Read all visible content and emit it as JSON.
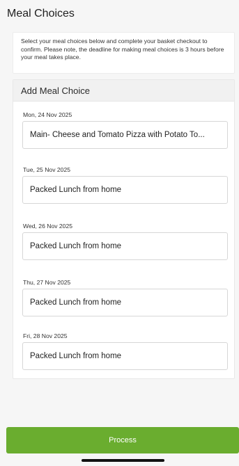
{
  "page": {
    "title": "Meal Choices"
  },
  "info": {
    "text": "Select your meal choices below and complete your basket checkout to confirm. Please note, the deadline for making meal choices is 3 hours before your meal takes place."
  },
  "meal_choice": {
    "header": "Add Meal Choice",
    "days": [
      {
        "date": "Mon, 24 Nov 2025",
        "selection": "Main- Cheese and Tomato Pizza with Potato To..."
      },
      {
        "date": "Tue, 25 Nov 2025",
        "selection": "Packed Lunch from home"
      },
      {
        "date": "Wed, 26 Nov 2025",
        "selection": "Packed Lunch from home"
      },
      {
        "date": "Thu, 27 Nov 2025",
        "selection": "Packed Lunch from home"
      },
      {
        "date": "Fri, 28 Nov 2025",
        "selection": "Packed Lunch from home"
      }
    ]
  },
  "actions": {
    "process_label": "Process"
  },
  "colors": {
    "accent": "#6aad2f",
    "background": "#f6f6f6"
  }
}
